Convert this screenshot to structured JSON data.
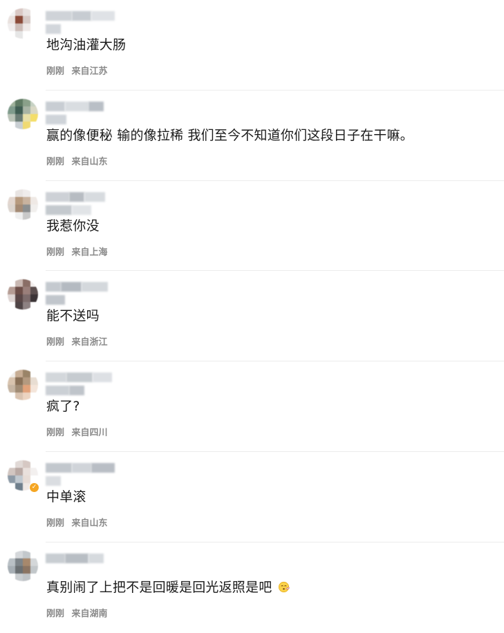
{
  "comments": [
    {
      "content": "地沟油灌大肠",
      "time": "刚刚",
      "location": "来自江苏",
      "avatar_colors": [
        "#f3f3f3",
        "#d9c8c4",
        "#e8e2e0",
        "#ffffff",
        "#e9e1de",
        "#8a4a38",
        "#d6c9c5",
        "#ffffff",
        "#f0eded",
        "#cdbdb8",
        "#efe9e7",
        "#ffffff",
        "#ffffff",
        "#e6e6e6",
        "#ffffff",
        "#ffffff"
      ],
      "nickname_colors": [
        "#cfd3d8",
        "#c7ccd2",
        "#dfe2e6",
        "#d2d6db"
      ],
      "badge": false
    },
    {
      "content": "赢的像便秘 输的像拉稀 我们至今不知道你们这段日子在干嘛。",
      "time": "刚刚",
      "location": "来自山东",
      "avatar_colors": [
        "#9fb29b",
        "#5f7a63",
        "#8aa08a",
        "#c7d2c4",
        "#7f9b8c",
        "#3f5d52",
        "#a8b4a5",
        "#d9d8c5",
        "#b9c2b6",
        "#6b7d75",
        "#e8e0a8",
        "#f4de6a",
        "#ffffff",
        "#c9cfd3",
        "#f0da72",
        "#ffffff"
      ],
      "nickname_colors": [
        "#c8cdd3",
        "#d9dde1",
        "#b9bfc6",
        "#cfd4d9"
      ],
      "badge": false
    },
    {
      "content": "我惹你没",
      "time": "刚刚",
      "location": "来自上海",
      "avatar_colors": [
        "#ffffff",
        "#e8e4e2",
        "#efeceb",
        "#ffffff",
        "#e2d6cf",
        "#b79a7e",
        "#c9b39f",
        "#efe9e5",
        "#dcd5cf",
        "#a48a74",
        "#8b8e8f",
        "#f1efed",
        "#ffffff",
        "#efefef",
        "#c9c9c9",
        "#ffffff"
      ],
      "nickname_colors": [
        "#cdd1d6",
        "#b7bcc2",
        "#d7dbdf",
        "#c4c9ce",
        "#e1e4e7"
      ],
      "badge": false
    },
    {
      "content": "能不送吗",
      "time": "刚刚",
      "location": "来自浙江",
      "avatar_colors": [
        "#ffffff",
        "#c9b8b2",
        "#8a6e66",
        "#f3efee",
        "#b59c94",
        "#6d4e48",
        "#9a7f7a",
        "#5b4e4e",
        "#ded5d3",
        "#5a4747",
        "#7c6b6b",
        "#3b3336",
        "#ffffff",
        "#4f4446",
        "#8d8182",
        "#ffffff"
      ],
      "nickname_colors": [
        "#c4c9cf",
        "#b4bac1",
        "#d4d8dc",
        "#c1c6cc"
      ],
      "badge": false
    },
    {
      "content": "疯了?",
      "time": "刚刚",
      "location": "来自四川",
      "avatar_colors": [
        "#f1ede9",
        "#c7ad94",
        "#9a8468",
        "#ffffff",
        "#d8c3ae",
        "#8a7158",
        "#b49a80",
        "#e8ddd2",
        "#c6b5a3",
        "#a08b74",
        "#e1a27a",
        "#f4e5da",
        "#ffffff",
        "#d9c3b0",
        "#ecd4c1",
        "#ffffff"
      ],
      "nickname_colors": [
        "#d3d7db",
        "#c6cbd0",
        "#dde0e4",
        "#cbd0d5",
        "#bfc4ca"
      ],
      "badge": false
    },
    {
      "content": "中单滚",
      "time": "刚刚",
      "location": "来自山东",
      "avatar_colors": [
        "#ffffff",
        "#e1d9d6",
        "#d6c8c3",
        "#ffffff",
        "#d2c6c1",
        "#b9a9a4",
        "#e9e0dc",
        "#f3f0ef",
        "#8d9aa6",
        "#c1c9d0",
        "#e7dcd6",
        "#ffffff",
        "#ffffff",
        "#6f7f8c",
        "#efe8e4",
        "#ffffff"
      ],
      "nickname_colors": [
        "#c2c7cd",
        "#d0d4d9",
        "#b9bec5",
        "#dadde1"
      ],
      "badge": true
    },
    {
      "content": "真别闹了上把不是回暖是回光返照是吧",
      "time": "刚刚",
      "location": "来自湖南",
      "avatar_colors": [
        "#ffffff",
        "#d5d8db",
        "#c3c8cc",
        "#ffffff",
        "#b9c0c5",
        "#7d8489",
        "#a7886c",
        "#d4d7d9",
        "#a6aeb4",
        "#6a6f72",
        "#8b7462",
        "#c2c7ca",
        "#ffffff",
        "#c9cdd0",
        "#bfc3c6",
        "#ffffff"
      ],
      "nickname_colors": [
        "#c8cdd2",
        "#b8bec4",
        "#d6dade"
      ],
      "badge": false,
      "emoji": "face-with-thermometer-emoji"
    }
  ]
}
